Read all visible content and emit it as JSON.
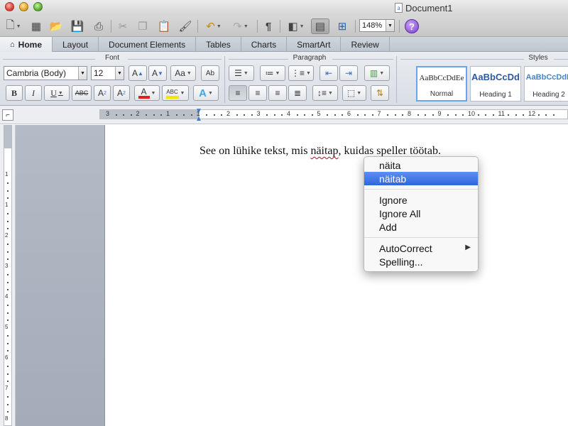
{
  "window": {
    "title": "Document1",
    "doc_icon_letter": "a"
  },
  "toolbar": {
    "zoom": "148%",
    "help": "?"
  },
  "tabs": [
    {
      "label": "Home",
      "active": true
    },
    {
      "label": "Layout"
    },
    {
      "label": "Document Elements"
    },
    {
      "label": "Tables"
    },
    {
      "label": "Charts"
    },
    {
      "label": "SmartArt"
    },
    {
      "label": "Review"
    }
  ],
  "ribbon": {
    "font_group_label": "Font",
    "paragraph_group_label": "Paragraph",
    "styles_group_label": "Styles",
    "font_name": "Cambria (Body)",
    "font_size": "12",
    "grow_font": "A",
    "shrink_font": "A",
    "change_case": "Aa",
    "spelling_label": "Ab",
    "bold": "B",
    "italic": "I",
    "underline": "U",
    "strikethrough": "ABC",
    "superscript": "A",
    "subscript": "A",
    "font_color": "A",
    "highlight": "ABC",
    "text_effects": "A",
    "styles": [
      {
        "sample": "AaBbCcDdEe",
        "name": "Normal"
      },
      {
        "sample": "AaBbCcDd",
        "name": "Heading 1"
      },
      {
        "sample": "AaBbCcDdE",
        "name": "Heading 2"
      }
    ]
  },
  "ruler": {
    "numbers": [
      "3",
      "2",
      "1",
      "1",
      "2",
      "3",
      "4",
      "5",
      "6",
      "7",
      "8",
      "9",
      "10",
      "11",
      "12"
    ],
    "vertical_numbers": [
      "1",
      "1",
      "2",
      "3",
      "4",
      "5",
      "6",
      "7",
      "8"
    ]
  },
  "document": {
    "before": "See on lühike tekst, mis ",
    "misspelled_word": "näitap",
    "after": ", kuidas speller töötab."
  },
  "context_menu": {
    "suggestions": [
      "näita",
      "näitab"
    ],
    "highlighted_index": 1,
    "ignore": "Ignore",
    "ignore_all": "Ignore All",
    "add": "Add",
    "autocorrect": "AutoCorrect",
    "spelling": "Spelling..."
  },
  "colors": {
    "highlight": "#2f66e0",
    "misspell_underline": "#d0021b",
    "font_color_bar": "#e02020",
    "highlight_bar": "#f2e600"
  }
}
